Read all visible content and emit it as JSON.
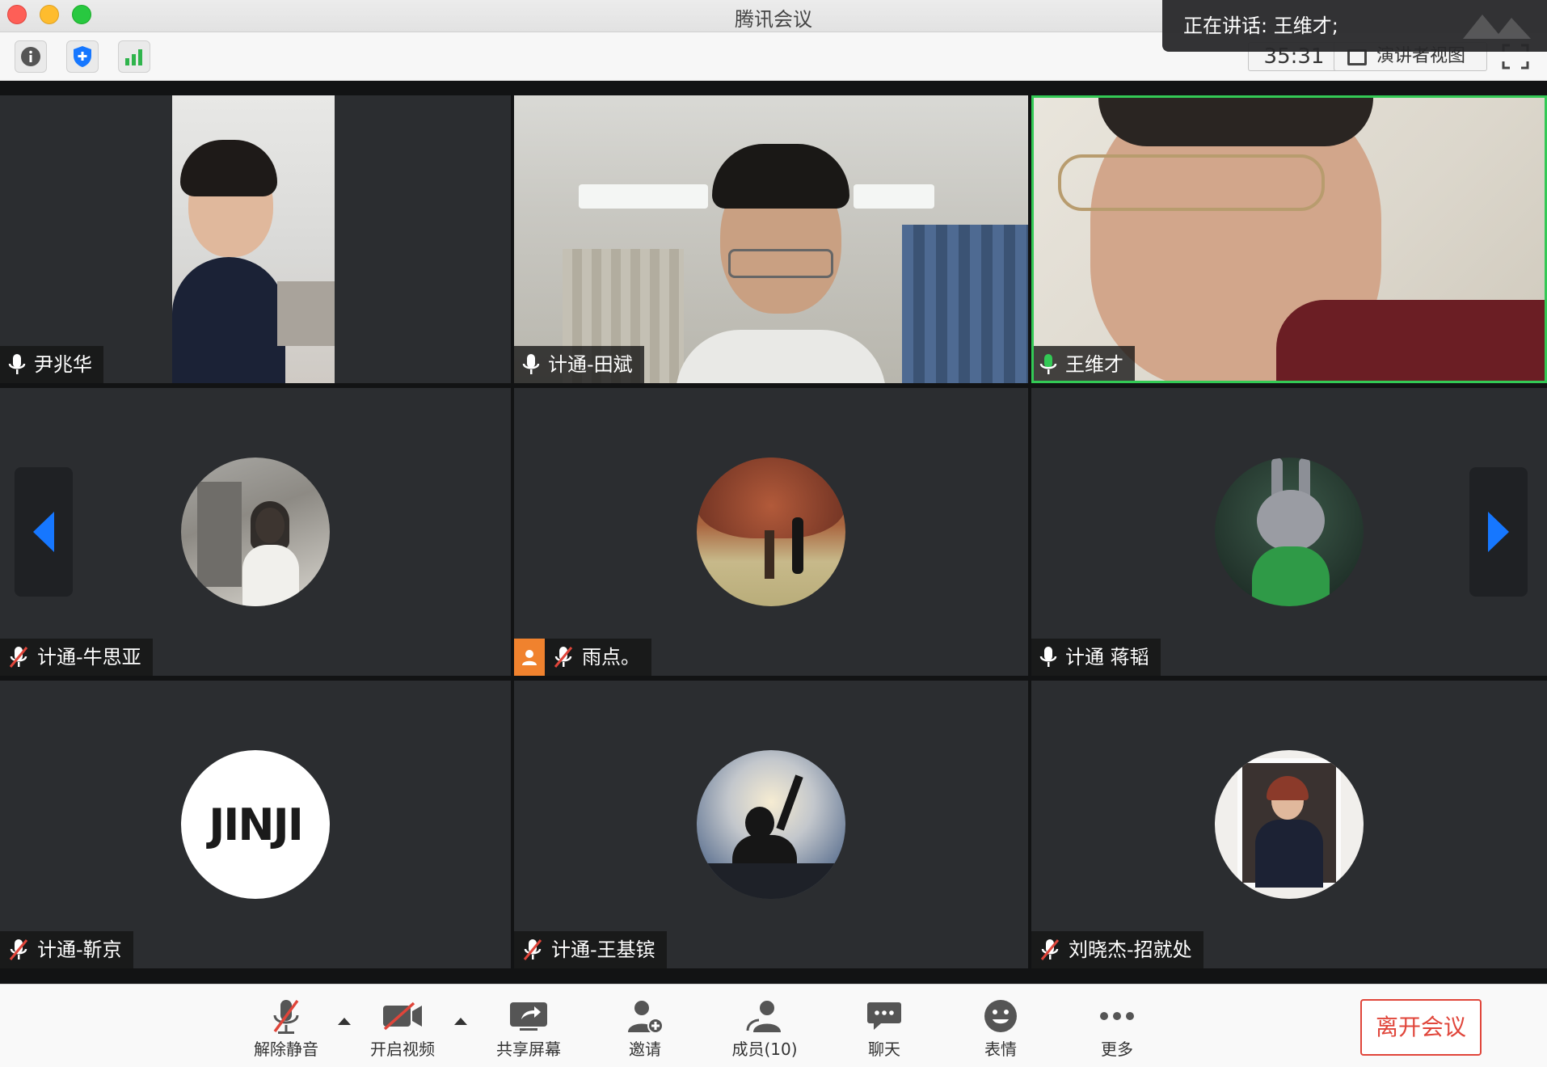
{
  "window": {
    "title": "腾讯会议"
  },
  "toolbar": {
    "timer": "35:31",
    "view_label": "演讲者视图"
  },
  "speaking": {
    "text": "正在讲话: 王维才;"
  },
  "participants": [
    {
      "name": "尹兆华",
      "mic": "on"
    },
    {
      "name": "计通-田斌",
      "mic": "on"
    },
    {
      "name": "王维才",
      "mic": "speaking"
    },
    {
      "name": "计通-牛思亚",
      "mic": "muted"
    },
    {
      "name": "雨点。",
      "mic": "muted"
    },
    {
      "name": "计通 蒋韬",
      "mic": "on"
    },
    {
      "name": "计通-靳京",
      "mic": "muted"
    },
    {
      "name": "计通-王基镔",
      "mic": "muted"
    },
    {
      "name": "刘晓杰-招就处",
      "mic": "muted"
    }
  ],
  "avatar_text": {
    "jinjing": "JINJI"
  },
  "controls": {
    "unmute": "解除静音",
    "video": "开启视频",
    "share": "共享屏幕",
    "invite": "邀请",
    "members": "成员(10)",
    "chat": "聊天",
    "reactions": "表情",
    "more": "更多",
    "leave": "离开会议"
  },
  "colors": {
    "active_border": "#33c955",
    "leave": "#e0453a",
    "accent_blue": "#1677ff"
  }
}
